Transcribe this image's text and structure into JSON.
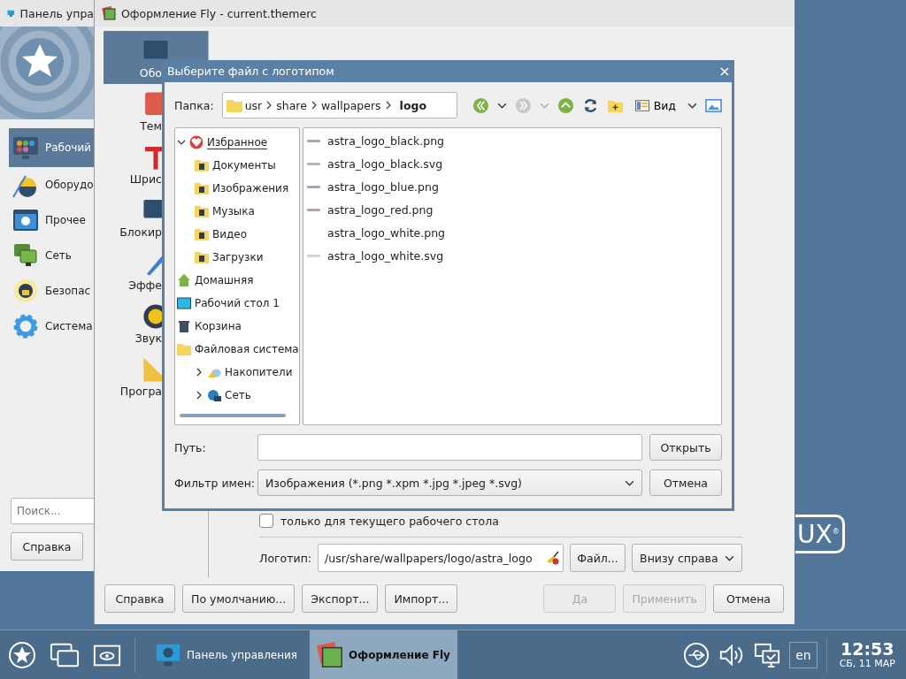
{
  "desktop": {
    "logo_text": "UX$^{®}$"
  },
  "control_panel": {
    "title": "Панель упра",
    "categories": [
      {
        "label": "Рабочий",
        "kind": "desktop",
        "selected": true
      },
      {
        "label": "Оборудо",
        "kind": "hardware",
        "selected": false
      },
      {
        "label": "Прочее",
        "kind": "other",
        "selected": false
      },
      {
        "label": "Сеть",
        "kind": "network",
        "selected": false
      },
      {
        "label": "Безопас",
        "kind": "security",
        "selected": false
      },
      {
        "label": "Система",
        "kind": "system",
        "selected": false
      }
    ],
    "search": {
      "placeholder": "Поиск..."
    },
    "help_button": "Справка"
  },
  "appearance_window": {
    "title": "Оформление Fly - current.themerc",
    "sections": [
      {
        "label": "Обо",
        "kind": "appearance",
        "selected": true
      },
      {
        "label": "Тем",
        "kind": "themes",
        "selected": false
      },
      {
        "label": "Шрис",
        "kind": "fonts",
        "selected": false
      },
      {
        "label": "Блокир",
        "kind": "lock",
        "selected": false
      },
      {
        "label": "Эффе",
        "kind": "effects",
        "selected": false
      },
      {
        "label": "Звук",
        "kind": "sound",
        "selected": false
      },
      {
        "label": "Програ",
        "kind": "programs",
        "selected": false
      }
    ],
    "only_current_desktop": {
      "label": "только для текущего рабочего стола",
      "checked": false
    },
    "logo": {
      "label": "Логотип:",
      "value": "/usr/share/wallpapers/logo/astra_logo",
      "file_button": "Файл...",
      "position": "Внизу справа"
    },
    "buttons": [
      {
        "label": "Справка",
        "disabled": false
      },
      {
        "label": "По умолчанию...",
        "disabled": false
      },
      {
        "label": "Экспорт...",
        "disabled": false
      },
      {
        "label": "Импорт...",
        "disabled": false
      },
      {
        "label": "Да",
        "disabled": true
      },
      {
        "label": "Применить",
        "disabled": true
      },
      {
        "label": "Отмена",
        "disabled": false
      }
    ]
  },
  "file_dialog": {
    "title": "Выберите файл с логотипом",
    "folder_label": "Папка:",
    "breadcrumb": [
      {
        "label": "usr",
        "current": false
      },
      {
        "label": "share",
        "current": false
      },
      {
        "label": "wallpapers",
        "current": false
      },
      {
        "label": "logo",
        "current": true
      }
    ],
    "nav_buttons": [
      {
        "kind": "back",
        "disabled": false
      },
      {
        "kind": "forward",
        "disabled": true
      },
      {
        "kind": "up",
        "disabled": false
      }
    ],
    "view_button": "Вид",
    "places": [
      {
        "label": "Избранное",
        "kind": "favorites",
        "expanded": true,
        "children": [
          {
            "label": "Документы",
            "kind": "documents"
          },
          {
            "label": "Изображения",
            "kind": "pictures"
          },
          {
            "label": "Музыка",
            "kind": "music"
          },
          {
            "label": "Видео",
            "kind": "video"
          },
          {
            "label": "Загрузки",
            "kind": "downloads"
          }
        ]
      },
      {
        "label": "Домашняя",
        "kind": "home"
      },
      {
        "label": "Рабочий стол 1",
        "kind": "desktop"
      },
      {
        "label": "Корзина",
        "kind": "trash"
      },
      {
        "label": "Файловая система",
        "kind": "filesystem",
        "children": [
          {
            "label": "Накопители",
            "kind": "drives",
            "expanded": false
          },
          {
            "label": "Сеть",
            "kind": "network",
            "expanded": false
          }
        ]
      }
    ],
    "files": [
      {
        "name": "astra_logo_black.png",
        "color": "#a8a8a8"
      },
      {
        "name": "astra_logo_black.svg",
        "color": "#b4b4b4"
      },
      {
        "name": "astra_logo_blue.png",
        "color": "#a0a6b4"
      },
      {
        "name": "astra_logo_red.png",
        "color": "#b4a4a4"
      },
      {
        "name": "astra_logo_white.png"
      },
      {
        "name": "astra_logo_white.svg",
        "color": "#d4d4d4"
      }
    ],
    "path_label": "Путь:",
    "open_button": "Открыть",
    "filter_label": "Фильтр имен:",
    "filter_value": "Изображения (*.png *.xpm *.jpg *.jpeg *.svg)",
    "cancel_button": "Отмена"
  },
  "taskbar": {
    "tasks": [
      {
        "label": "Панель управления",
        "kind": "control_panel",
        "selected": false
      },
      {
        "label": "Оформление Fly",
        "kind": "appearance",
        "selected": true
      }
    ],
    "keyboard_layout": "en",
    "time": "12:53",
    "date": "СБ, 11 МАР"
  }
}
